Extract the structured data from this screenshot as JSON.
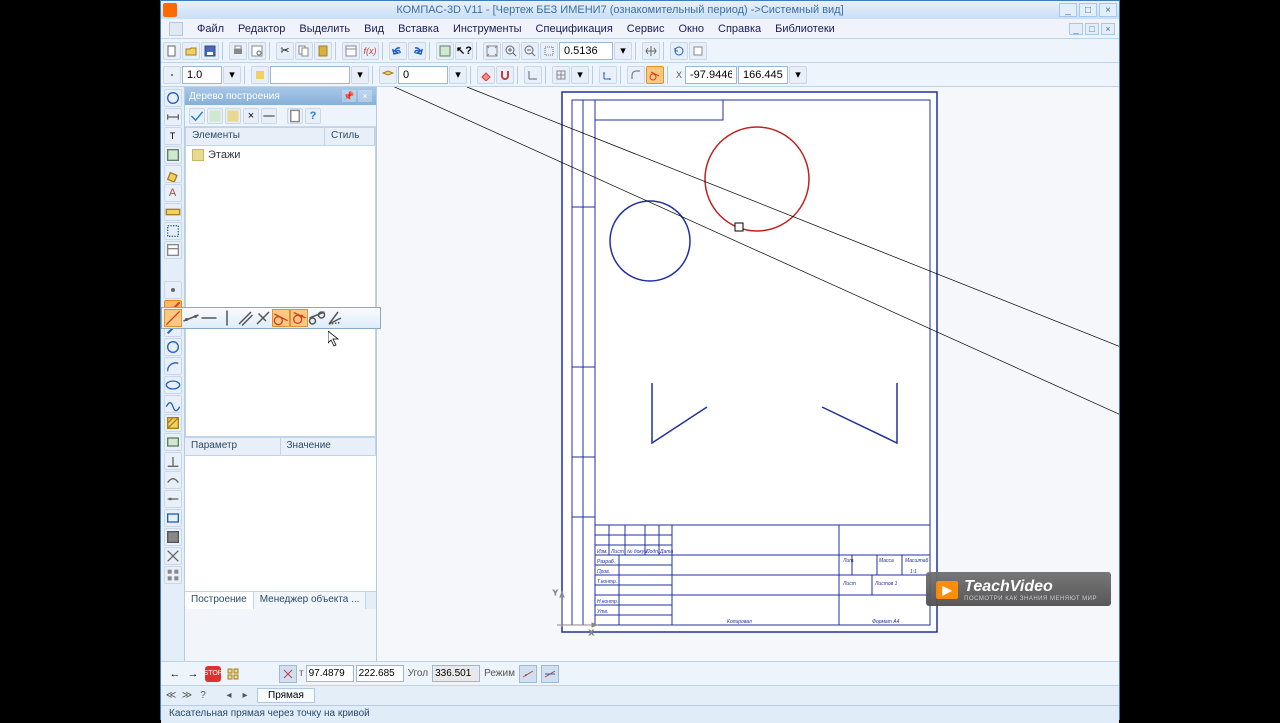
{
  "title": "КОМПАС-3D V11 - [Чертеж БЕЗ ИМЕНИ7 (ознакомительный период) ->Системный вид]",
  "menu": [
    "Файл",
    "Редактор",
    "Выделить",
    "Вид",
    "Вставка",
    "Инструменты",
    "Спецификация",
    "Сервис",
    "Окно",
    "Справка",
    "Библиотеки"
  ],
  "toolbar2": {
    "scale_input": "1.0",
    "layer_input": "0"
  },
  "zoom_input": "0.5136",
  "coord_x": "-97.9446",
  "coord_y": "166.445",
  "tree": {
    "panel_title": "Дерево построения",
    "col1": "Элементы",
    "col2": "Стиль",
    "items": [
      "Этажи"
    ]
  },
  "props": {
    "col1": "Параметр",
    "col2": "Значение"
  },
  "panel_tabs": [
    "Построение",
    "Менеджер объекта ..."
  ],
  "property_bar": {
    "x": "97.4879",
    "y": "222.685",
    "angle_label": "Угол",
    "angle": "336.501",
    "mode_label": "Режим"
  },
  "doc_tab": "Прямая",
  "status": "Касательная прямая через точку на кривой",
  "watermark": {
    "brand": "TeachVideo",
    "sub": "ПОСМОТРИ КАК ЗНАНИЯ МЕНЯЮТ МИР"
  },
  "title_block": {
    "format": "Формат    A4",
    "kopiroval": "Копировал",
    "fields": [
      "Изм.",
      "Лист",
      "№ докум.",
      "Подп.",
      "Дата"
    ],
    "roles": [
      "Разраб.",
      "Пров.",
      "Т.контр.",
      "",
      "Н.контр.",
      "Утв."
    ],
    "right": [
      "Лит.",
      "Масса",
      "Масштаб",
      "1:1",
      "Лист",
      "Листов   1"
    ]
  }
}
